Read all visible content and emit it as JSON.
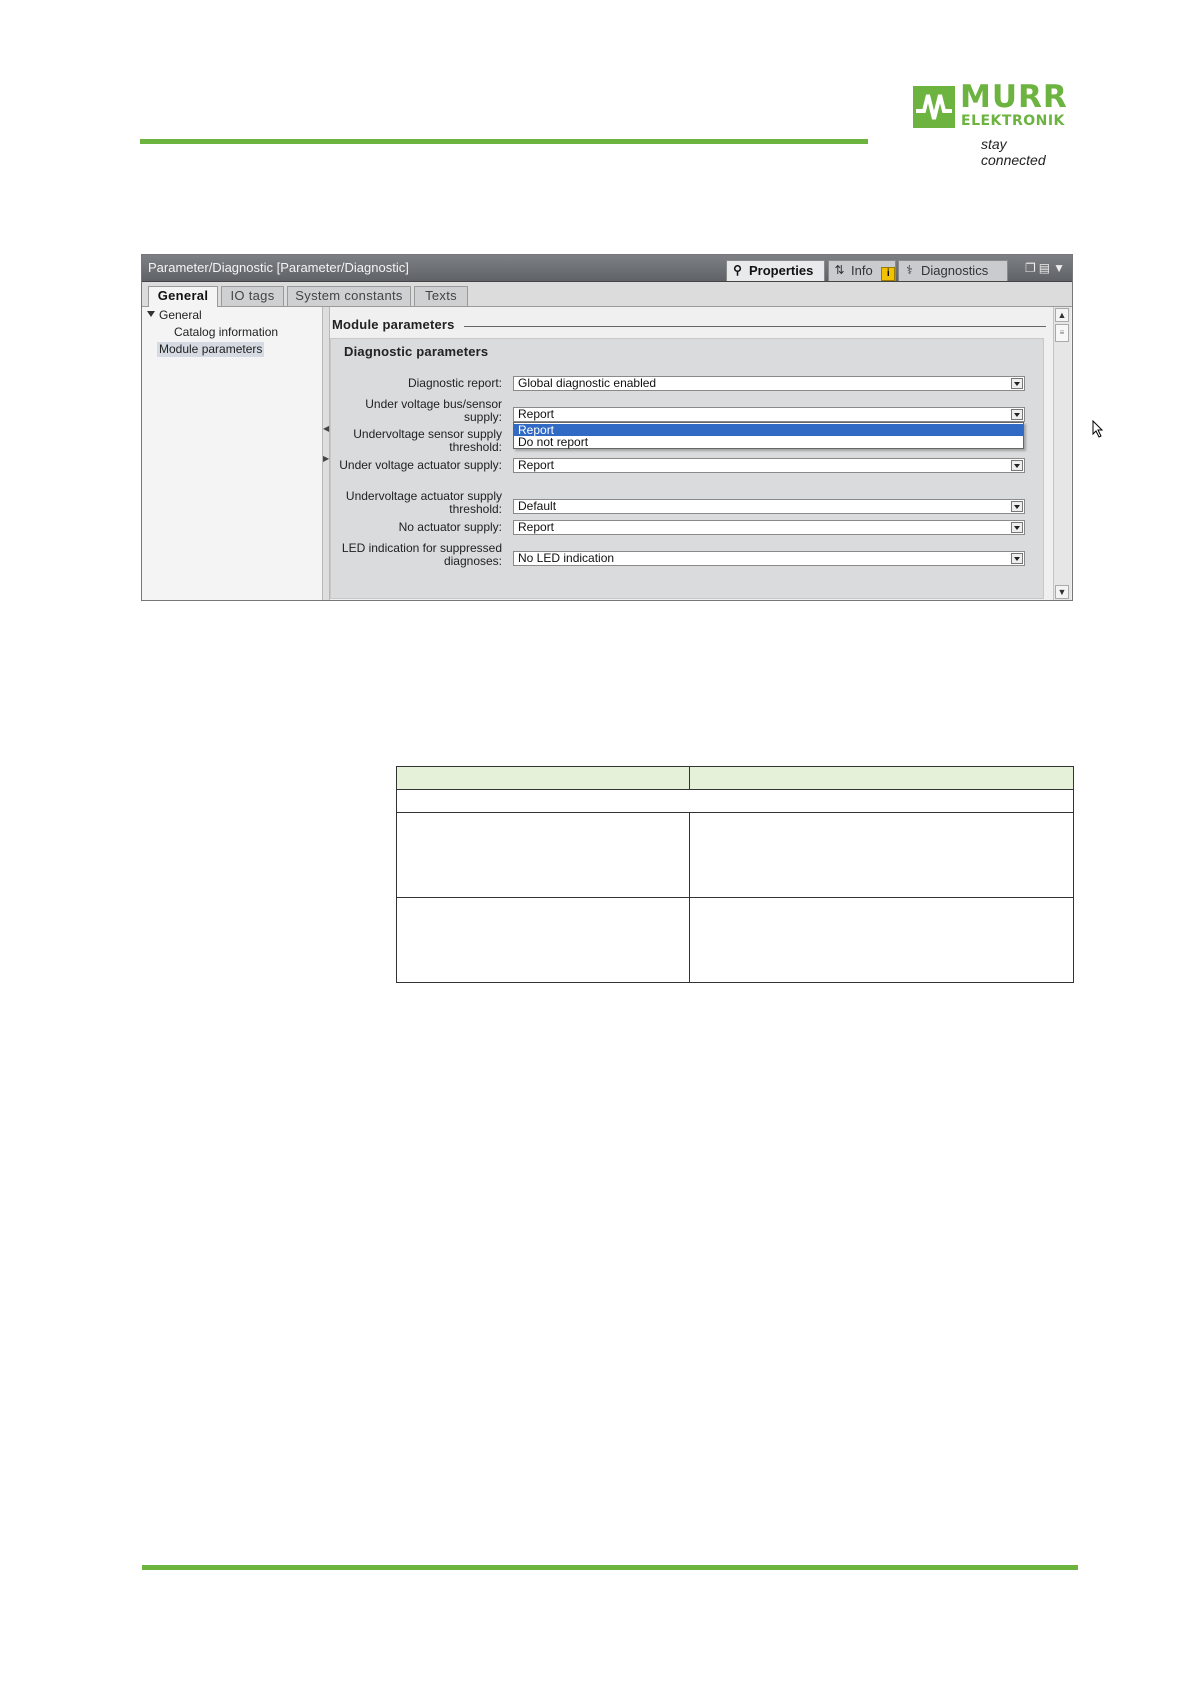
{
  "logo": {
    "brand": "MURR",
    "brand_sub": "ELEKTRONIK",
    "tagline": "stay connected",
    "color": "#6cb33f"
  },
  "window": {
    "title": "Parameter/Diagnostic [Parameter/Diagnostic]",
    "panel_tabs": [
      {
        "label": "Properties",
        "icon": "properties-icon",
        "active": true
      },
      {
        "label": "Info",
        "icon": "info-icon",
        "badge": "i"
      },
      {
        "label": "Diagnostics",
        "icon": "diagnostics-icon"
      }
    ],
    "tabs": [
      "General",
      "IO tags",
      "System constants",
      "Texts"
    ],
    "nav": {
      "root": "General",
      "items": [
        "Catalog information",
        "Module parameters"
      ]
    },
    "section_title": "Module parameters",
    "group_title": "Diagnostic parameters",
    "params": [
      {
        "label_lines": [
          "Diagnostic report:"
        ],
        "value": "Global diagnostic enabled"
      },
      {
        "label_lines": [
          "Under voltage bus/sensor",
          "supply:"
        ],
        "value": "Report"
      },
      {
        "label_lines": [
          "Undervoltage sensor supply",
          "threshold:"
        ],
        "value": ""
      },
      {
        "label_lines": [
          "Under voltage actuator supply:"
        ],
        "value": "Report"
      },
      {
        "label_lines": [
          "Undervoltage actuator supply",
          "threshold:"
        ],
        "value": "Default"
      },
      {
        "label_lines": [
          "No actuator supply:"
        ],
        "value": "Report"
      },
      {
        "label_lines": [
          "LED indication for suppressed",
          "diagnoses:"
        ],
        "value": "No LED indication"
      }
    ],
    "dropdown_options": [
      {
        "label": "Report",
        "selected": true
      },
      {
        "label": "Do not report",
        "selected": false
      }
    ],
    "selection_color": "#316ac5"
  },
  "table": {
    "header": [
      "",
      ""
    ],
    "subheader": "",
    "rows": [
      [
        "",
        ""
      ],
      [
        "",
        ""
      ]
    ],
    "header_color": "#e5f2d9"
  }
}
